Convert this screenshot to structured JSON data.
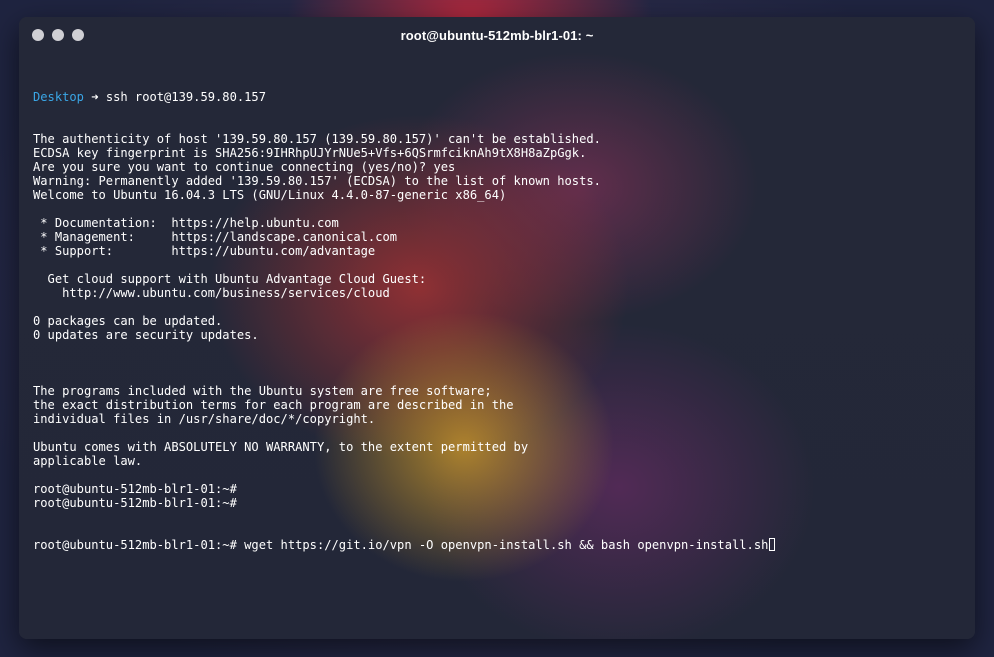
{
  "window": {
    "title": "root@ubuntu-512mb-blr1-01: ~"
  },
  "terminal": {
    "first_line": {
      "directory": "Desktop",
      "arrow": "➜",
      "command": "ssh root@139.59.80.157"
    },
    "lines": [
      "The authenticity of host '139.59.80.157 (139.59.80.157)' can't be established.",
      "ECDSA key fingerprint is SHA256:9IHRhpUJYrNUe5+Vfs+6QSrmfciknAh9tX8H8aZpGgk.",
      "Are you sure you want to continue connecting (yes/no)? yes",
      "Warning: Permanently added '139.59.80.157' (ECDSA) to the list of known hosts.",
      "Welcome to Ubuntu 16.04.3 LTS (GNU/Linux 4.4.0-87-generic x86_64)",
      "",
      " * Documentation:  https://help.ubuntu.com",
      " * Management:     https://landscape.canonical.com",
      " * Support:        https://ubuntu.com/advantage",
      "",
      "  Get cloud support with Ubuntu Advantage Cloud Guest:",
      "    http://www.ubuntu.com/business/services/cloud",
      "",
      "0 packages can be updated.",
      "0 updates are security updates.",
      "",
      "",
      "",
      "The programs included with the Ubuntu system are free software;",
      "the exact distribution terms for each program are described in the",
      "individual files in /usr/share/doc/*/copyright.",
      "",
      "Ubuntu comes with ABSOLUTELY NO WARRANTY, to the extent permitted by",
      "applicable law.",
      "",
      "root@ubuntu-512mb-blr1-01:~#",
      "root@ubuntu-512mb-blr1-01:~#"
    ],
    "prompt": "root@ubuntu-512mb-blr1-01:~#",
    "current_input": " wget https://git.io/vpn -O openvpn-install.sh && bash openvpn-install.sh"
  },
  "colors": {
    "directory": "#3aa6e6",
    "text": "#ffffff",
    "window_bg": "#252a38"
  }
}
